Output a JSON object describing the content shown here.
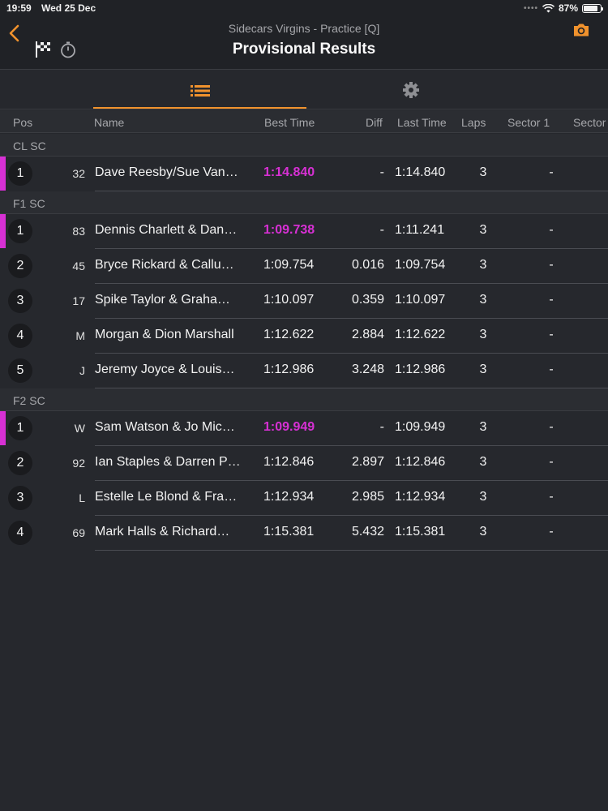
{
  "status": {
    "time": "19:59",
    "date": "Wed 25 Dec",
    "battery": "87%"
  },
  "header": {
    "subtitle": "Sidecars Virgins - Practice [Q]",
    "title": "Provisional Results"
  },
  "tabs": [
    "list-icon",
    "gear-icon"
  ],
  "columns": {
    "pos": "Pos",
    "name": "Name",
    "best": "Best Time",
    "diff": "Diff",
    "last": "Last Time",
    "laps": "Laps",
    "sector1": "Sector 1",
    "sector2": "Sector"
  },
  "colors": {
    "accent": "#f0922d",
    "fastest": "#d730d4"
  },
  "groups": [
    {
      "label": "CL SC",
      "rows": [
        {
          "pos": "1",
          "num": "32",
          "name": "Dave Reesby/Sue Van…",
          "best": "1:14.840",
          "diff": "-",
          "last": "1:14.840",
          "laps": "3",
          "s1": "-",
          "fastest": true
        }
      ]
    },
    {
      "label": "F1 SC",
      "rows": [
        {
          "pos": "1",
          "num": "83",
          "name": "Dennis Charlett & Dan…",
          "best": "1:09.738",
          "diff": "-",
          "last": "1:11.241",
          "laps": "3",
          "s1": "-",
          "fastest": true
        },
        {
          "pos": "2",
          "num": "45",
          "name": "Bryce Rickard & Callu…",
          "best": "1:09.754",
          "diff": "0.016",
          "last": "1:09.754",
          "laps": "3",
          "s1": "-",
          "fastest": false
        },
        {
          "pos": "3",
          "num": "17",
          "name": "Spike Taylor & Graha…",
          "best": "1:10.097",
          "diff": "0.359",
          "last": "1:10.097",
          "laps": "3",
          "s1": "-",
          "fastest": false
        },
        {
          "pos": "4",
          "num": "M",
          "name": "Morgan & Dion Marshall",
          "best": "1:12.622",
          "diff": "2.884",
          "last": "1:12.622",
          "laps": "3",
          "s1": "-",
          "fastest": false
        },
        {
          "pos": "5",
          "num": "J",
          "name": "Jeremy Joyce & Louis…",
          "best": "1:12.986",
          "diff": "3.248",
          "last": "1:12.986",
          "laps": "3",
          "s1": "-",
          "fastest": false
        }
      ]
    },
    {
      "label": "F2 SC",
      "rows": [
        {
          "pos": "1",
          "num": "W",
          "name": "Sam Watson & Jo Mic…",
          "best": "1:09.949",
          "diff": "-",
          "last": "1:09.949",
          "laps": "3",
          "s1": "-",
          "fastest": true
        },
        {
          "pos": "2",
          "num": "92",
          "name": "Ian Staples & Darren P…",
          "best": "1:12.846",
          "diff": "2.897",
          "last": "1:12.846",
          "laps": "3",
          "s1": "-",
          "fastest": false
        },
        {
          "pos": "3",
          "num": "L",
          "name": "Estelle Le Blond & Fra…",
          "best": "1:12.934",
          "diff": "2.985",
          "last": "1:12.934",
          "laps": "3",
          "s1": "-",
          "fastest": false
        },
        {
          "pos": "4",
          "num": "69",
          "name": "Mark Halls & Richard…",
          "best": "1:15.381",
          "diff": "5.432",
          "last": "1:15.381",
          "laps": "3",
          "s1": "-",
          "fastest": false
        }
      ]
    }
  ]
}
